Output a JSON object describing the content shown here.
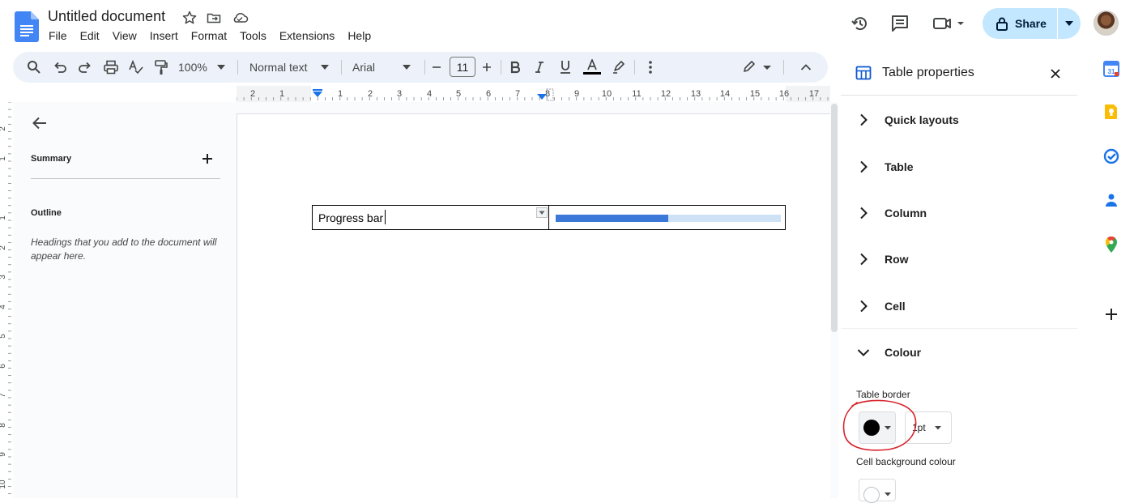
{
  "header": {
    "title": "Untitled document",
    "menu": [
      "File",
      "Edit",
      "View",
      "Insert",
      "Format",
      "Tools",
      "Extensions",
      "Help"
    ],
    "share_label": "Share"
  },
  "toolbar": {
    "zoom": "100%",
    "style": "Normal text",
    "font": "Arial",
    "font_size": "11"
  },
  "ruler": {
    "labels": [
      "2",
      "1",
      "1",
      "2",
      "3",
      "4",
      "5",
      "6",
      "7",
      "8",
      "9",
      "10",
      "11",
      "12",
      "13",
      "14",
      "15",
      "16",
      "17"
    ]
  },
  "vruler": {
    "labels": [
      "2",
      "1",
      "1",
      "2",
      "3",
      "4",
      "5",
      "6",
      "7",
      "8",
      "9",
      "10"
    ]
  },
  "outline_panel": {
    "summary_label": "Summary",
    "outline_label": "Outline",
    "hint": "Headings that you add to the document will appear here."
  },
  "document": {
    "table": {
      "cell1_text": "Progress bar",
      "progress_fraction": 0.5
    }
  },
  "properties_panel": {
    "title": "Table properties",
    "sections": [
      "Quick layouts",
      "Table",
      "Column",
      "Row",
      "Cell"
    ],
    "expanded_section": "Colour",
    "table_border_label": "Table border",
    "border_width": "1pt",
    "cell_background_label": "Cell background colour"
  },
  "colors": {
    "accent": "#0b57d0",
    "share_bg": "#c2e7ff",
    "toolbar_bg": "#edf2fa",
    "progress_fill": "#3c78d8",
    "progress_track": "#cfe2f5",
    "annotation": "#d6232a"
  },
  "icons": {
    "header": [
      "docs-logo",
      "star-icon",
      "move-folder-icon",
      "cloud-icon",
      "history-icon",
      "comment-icon",
      "meet-icon",
      "lock-icon"
    ],
    "rail": [
      "calendar-icon",
      "keep-icon",
      "tasks-icon",
      "contacts-icon",
      "maps-icon",
      "add-icon"
    ]
  }
}
